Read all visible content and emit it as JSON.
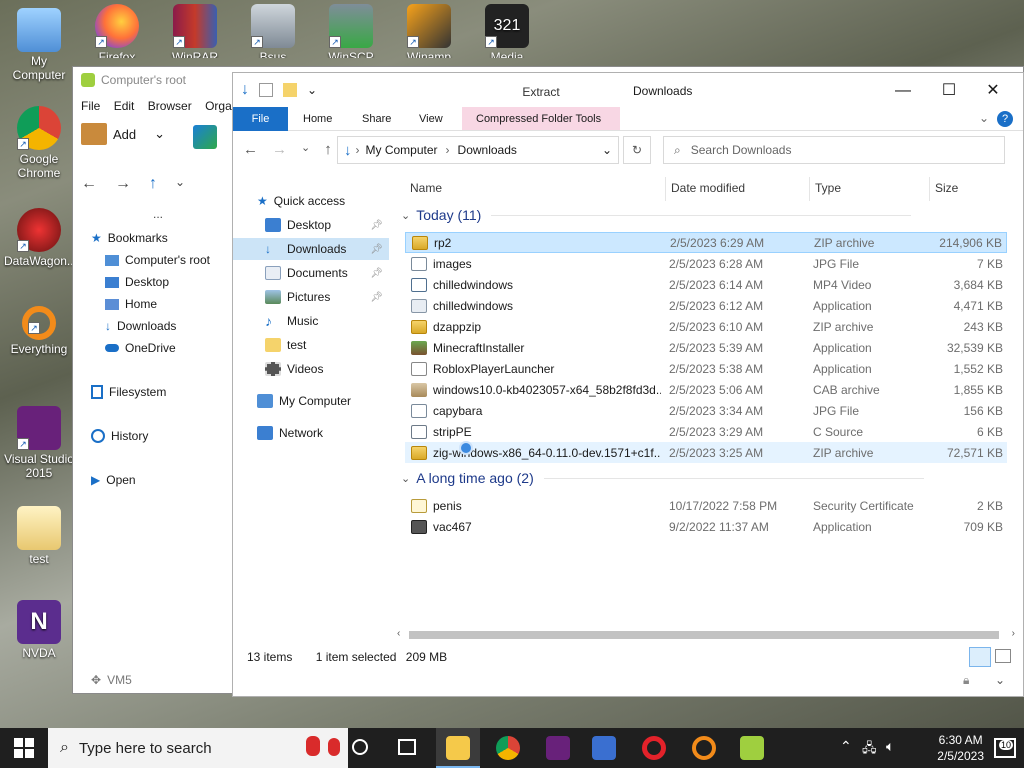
{
  "desktop": {
    "icons": [
      {
        "label": "My Computer"
      },
      {
        "label": "Firefox"
      },
      {
        "label": "WinRAR"
      },
      {
        "label": "Bsus"
      },
      {
        "label": "WinSCP"
      },
      {
        "label": "Winamp"
      },
      {
        "label": "Media Player"
      },
      {
        "label": "Google Chrome"
      },
      {
        "label": "DataWagon..."
      },
      {
        "label": "Everything"
      },
      {
        "label": "Visual Studio 2015"
      },
      {
        "label": "test"
      },
      {
        "label": "NVDA"
      }
    ]
  },
  "back_window": {
    "title": "Computer's root",
    "menu": [
      "File",
      "Edit",
      "Browser",
      "Orgar"
    ],
    "add_label": "Add",
    "ellipsis": "...",
    "sidebar": {
      "bookmarks": "Bookmarks",
      "items": [
        "Computer's root",
        "Desktop",
        "Home",
        "Downloads",
        "OneDrive"
      ],
      "filesystem": "Filesystem",
      "history": "History",
      "open": "Open",
      "vm": "VM5"
    }
  },
  "explorer": {
    "title": "Downloads",
    "extract_label": "Extract",
    "tabs": [
      "File",
      "Home",
      "Share",
      "View",
      "Compressed Folder Tools"
    ],
    "address": {
      "root": "My Computer",
      "current": "Downloads"
    },
    "search_placeholder": "Search Downloads",
    "nav": {
      "quick_access": "Quick access",
      "items": [
        "Desktop",
        "Downloads",
        "Documents",
        "Pictures",
        "Music",
        "test",
        "Videos"
      ],
      "my_computer": "My Computer",
      "network": "Network"
    },
    "columns": {
      "name": "Name",
      "date": "Date modified",
      "type": "Type",
      "size": "Size"
    },
    "groups": [
      {
        "label": "Today (11)",
        "files": [
          {
            "name": "rp2",
            "date": "2/5/2023 6:29 AM",
            "type": "ZIP archive",
            "size": "214,906 KB",
            "icon": "zip"
          },
          {
            "name": "images",
            "date": "2/5/2023 6:28 AM",
            "type": "JPG File",
            "size": "7 KB",
            "icon": "jpg"
          },
          {
            "name": "chilledwindows",
            "date": "2/5/2023 6:14 AM",
            "type": "MP4 Video",
            "size": "3,684 KB",
            "icon": "mp4"
          },
          {
            "name": "chilledwindows",
            "date": "2/5/2023 6:12 AM",
            "type": "Application",
            "size": "4,471 KB",
            "icon": "app"
          },
          {
            "name": "dzappzip",
            "date": "2/5/2023 6:10 AM",
            "type": "ZIP archive",
            "size": "243 KB",
            "icon": "zip"
          },
          {
            "name": "MinecraftInstaller",
            "date": "2/5/2023 5:39 AM",
            "type": "Application",
            "size": "32,539 KB",
            "icon": "mc"
          },
          {
            "name": "RobloxPlayerLauncher",
            "date": "2/5/2023 5:38 AM",
            "type": "Application",
            "size": "1,552 KB",
            "icon": "roblox"
          },
          {
            "name": "windows10.0-kb4023057-x64_58b2f8fd3d...",
            "date": "2/5/2023 5:06 AM",
            "type": "CAB archive",
            "size": "1,855 KB",
            "icon": "cab"
          },
          {
            "name": "capybara",
            "date": "2/5/2023 3:34 AM",
            "type": "JPG File",
            "size": "156 KB",
            "icon": "jpg"
          },
          {
            "name": "stripPE",
            "date": "2/5/2023 3:29 AM",
            "type": "C Source",
            "size": "6 KB",
            "icon": "c"
          },
          {
            "name": "zig-windows-x86_64-0.11.0-dev.1571+c1f...",
            "date": "2/5/2023 3:25 AM",
            "type": "ZIP archive",
            "size": "72,571 KB",
            "icon": "zip"
          }
        ]
      },
      {
        "label": "A long time ago (2)",
        "files": [
          {
            "name": "penis",
            "date": "10/17/2022 7:58 PM",
            "type": "Security Certificate",
            "size": "2 KB",
            "icon": "cert"
          },
          {
            "name": "vac467",
            "date": "9/2/2022 11:37 AM",
            "type": "Application",
            "size": "709 KB",
            "icon": "vac"
          }
        ]
      }
    ],
    "status": {
      "count": "13 items",
      "selected": "1 item selected",
      "size": "209 MB"
    }
  },
  "taskbar": {
    "search_placeholder": "Type here to search",
    "time": "6:30 AM",
    "date": "2/5/2023",
    "notifications": "10"
  }
}
